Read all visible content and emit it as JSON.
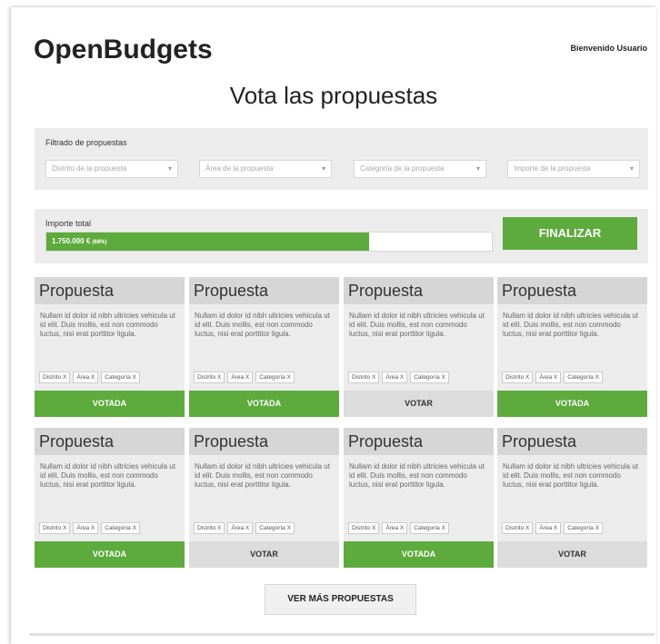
{
  "header": {
    "logo": "OpenBudgets",
    "welcome": "Bienvenido Usuario",
    "title": "Vota las propuestas"
  },
  "filters": {
    "label": "Filtrado de propuestas",
    "selects": [
      {
        "placeholder": "Distrito de la propuesta"
      },
      {
        "placeholder": "Área de la propuesta"
      },
      {
        "placeholder": "Categoría de la propuesta"
      },
      {
        "placeholder": "Importe de la propuesta"
      }
    ]
  },
  "budget": {
    "label": "Importe total",
    "amount": "1.750.000 €",
    "percent_label": "(68%)",
    "progress": 0.725,
    "finalize_label": "FINALIZAR"
  },
  "cards": [
    {
      "title": "Propuesta",
      "desc": "Nullam id dolor id nibh ultricies vehicula ut id elit. Duis mollis, est non commodo luctus, nisi erat porttitor ligula.",
      "tags": [
        "Distrito X",
        "Área X",
        "Categoría X"
      ],
      "button": "VOTADA",
      "voted": true
    },
    {
      "title": "Propuesta",
      "desc": "Nullam id dolor id nibh ultricies vehicula ut id elit. Duis mollis, est non commodo luctus, nisi erat porttitor ligula.",
      "tags": [
        "Distrito X",
        "Área X",
        "Categoría X"
      ],
      "button": "VOTADA",
      "voted": true
    },
    {
      "title": "Propuesta",
      "desc": "Nullam id dolor id nibh ultricies vehicula ut id elit. Duis mollis, est non commodo luctus, nisi erat porttitor ligula.",
      "tags": [
        "Distrito X",
        "Área X",
        "Categoría X"
      ],
      "button": "VOTAR",
      "voted": false
    },
    {
      "title": "Propuesta",
      "desc": "Nullam id dolor id nibh ultricies vehicula ut id elit. Duis mollis, est non commodo luctus, nisi erat porttitor ligula.",
      "tags": [
        "Distrito X",
        "Área X",
        "Categoría X"
      ],
      "button": "VOTADA",
      "voted": true
    },
    {
      "title": "Propuesta",
      "desc": "Nullam id dolor id nibh ultricies vehicula ut id elit. Duis mollis, est non commodo luctus, nisi erat porttitor ligula.",
      "tags": [
        "Distrito X",
        "Área X",
        "Categoría X"
      ],
      "button": "VOTADA",
      "voted": true
    },
    {
      "title": "Propuesta",
      "desc": "Nullam id dolor id nibh ultricies vehicula ut id elit. Duis mollis, est non commodo luctus, nisi erat porttitor ligula.",
      "tags": [
        "Distrito X",
        "Área X",
        "Categoría X"
      ],
      "button": "VOTAR",
      "voted": false
    },
    {
      "title": "Propuesta",
      "desc": "Nullam id dolor id nibh ultricies vehicula ut id elit. Duis mollis, est non commodo luctus, nisi erat porttitor ligula.",
      "tags": [
        "Distrito X",
        "Área X",
        "Categoría X"
      ],
      "button": "VOTADA",
      "voted": true
    },
    {
      "title": "Propuesta",
      "desc": "Nullam id dolor id nibh ultricies vehicula ut id elit. Duis mollis, est non commodo luctus, nisi erat porttitor ligula.",
      "tags": [
        "Distrito X",
        "Área X",
        "Categoría X"
      ],
      "button": "VOTAR",
      "voted": false
    }
  ],
  "more_label": "VER MÁS PROPUESTAS",
  "colors": {
    "accent": "#5eab3d",
    "panel": "#ececec",
    "card_header": "#d6d6d6",
    "vote_button": "#dcdcdc"
  },
  "icons": {
    "select_chevron": "chevron-down-icon"
  }
}
